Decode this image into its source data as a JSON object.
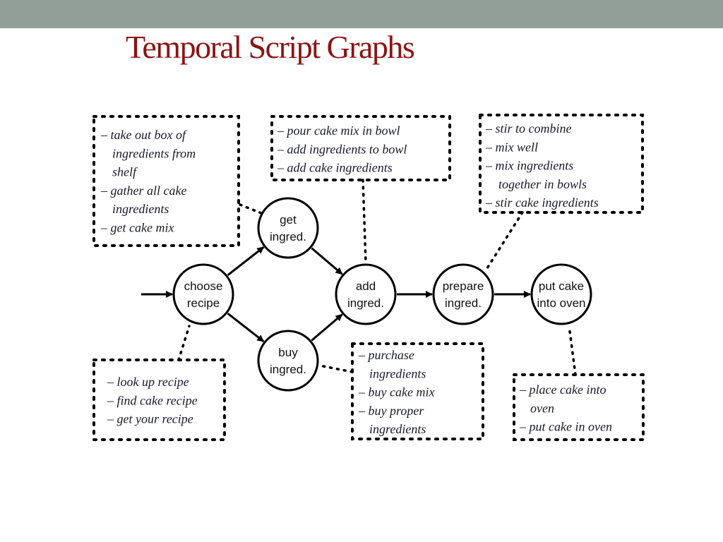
{
  "slide": {
    "title": "Temporal Script Graphs"
  },
  "diagram": {
    "nodes": [
      {
        "id": "choose",
        "lines": [
          "choose",
          "recipe"
        ]
      },
      {
        "id": "get",
        "lines": [
          "get",
          "ingred."
        ]
      },
      {
        "id": "buy",
        "lines": [
          "buy",
          "ingred."
        ]
      },
      {
        "id": "add",
        "lines": [
          "add",
          "ingred."
        ]
      },
      {
        "id": "prepare",
        "lines": [
          "prepare",
          "ingred."
        ]
      },
      {
        "id": "oven",
        "lines": [
          "put cake",
          "into oven"
        ]
      }
    ],
    "edges": [
      {
        "from": "start",
        "to": "choose"
      },
      {
        "from": "choose",
        "to": "get"
      },
      {
        "from": "choose",
        "to": "buy"
      },
      {
        "from": "get",
        "to": "add"
      },
      {
        "from": "buy",
        "to": "add"
      },
      {
        "from": "add",
        "to": "prepare"
      },
      {
        "from": "prepare",
        "to": "oven"
      }
    ],
    "boxes": [
      {
        "id": "get-box",
        "node": "get",
        "lines": [
          "– take out box of",
          "ingredients from",
          "shelf",
          "– gather all cake",
          "ingredients",
          "– get cake mix"
        ]
      },
      {
        "id": "add-box",
        "node": "add",
        "lines": [
          "– pour cake mix in bowl",
          "– add ingredients to bowl",
          "– add cake ingredients"
        ]
      },
      {
        "id": "prepare-box",
        "node": "prepare",
        "lines": [
          "– stir to combine",
          "– mix well",
          "– mix ingredients",
          "together in bowls",
          "– stir cake ingredients"
        ]
      },
      {
        "id": "choose-box",
        "node": "choose",
        "lines": [
          "– look up recipe",
          "– find cake recipe",
          "– get your recipe"
        ]
      },
      {
        "id": "buy-box",
        "node": "buy",
        "lines": [
          "– purchase",
          "ingredients",
          "– buy cake mix",
          "– buy proper",
          "ingredients"
        ]
      },
      {
        "id": "oven-box",
        "node": "oven",
        "lines": [
          "– place cake into",
          "oven",
          "– put cake in oven"
        ]
      }
    ]
  }
}
